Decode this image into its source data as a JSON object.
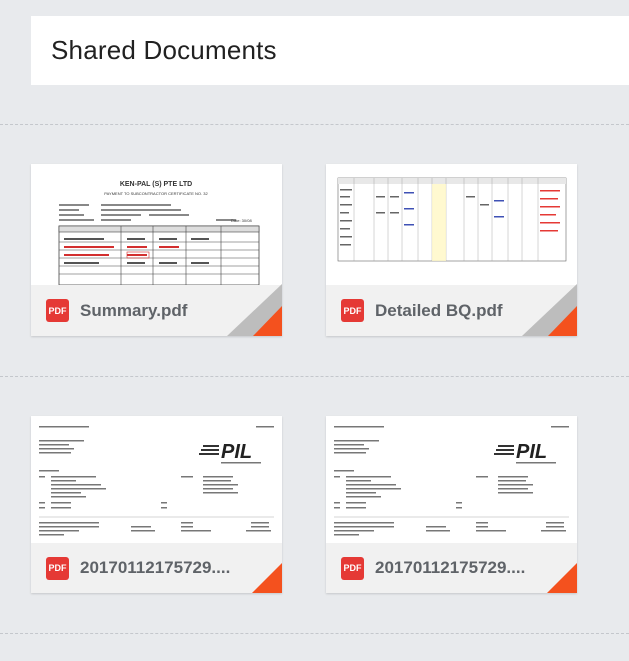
{
  "header": {
    "title": "Shared Documents"
  },
  "files": [
    {
      "name": "Summary.pdf",
      "type_label": "PDF",
      "preview": {
        "title": "KEN-PAL (S) PTE LTD",
        "subtitle": "PAYMENT TO SUBCONTRACTOR CERTIFICATE NO. 32"
      }
    },
    {
      "name": "Detailed BQ.pdf",
      "type_label": "PDF",
      "preview": {}
    },
    {
      "name": "20170112175729....",
      "type_label": "PDF",
      "preview": {
        "brand": "PIL"
      }
    },
    {
      "name": "20170112175729....",
      "type_label": "PDF",
      "preview": {
        "brand": "PIL"
      }
    }
  ],
  "colors": {
    "accent": "#f4511e",
    "pdf_badge": "#e53935",
    "corner_shade": "#bdbdbd"
  }
}
